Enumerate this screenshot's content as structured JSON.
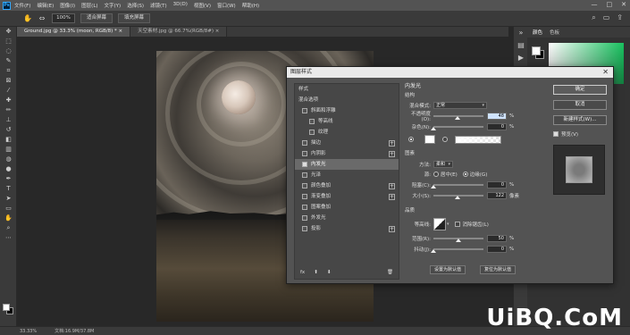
{
  "menubar": {
    "logo": "Ps",
    "items": [
      "文件(F)",
      "编辑(E)",
      "图像(I)",
      "图层(L)",
      "文字(Y)",
      "选择(S)",
      "滤镜(T)",
      "3D(D)",
      "视图(V)",
      "窗口(W)",
      "帮助(H)"
    ],
    "window_controls": [
      "—",
      "□",
      "✕"
    ]
  },
  "options": {
    "zoom_value": "100%",
    "fit_screen": "适合屏幕",
    "fill_screen": "填充屏幕"
  },
  "tabs": [
    {
      "label": "Ground.jpg @ 33.3% (moon, RGB/8) * ×",
      "active": true
    },
    {
      "label": "天空素材.jpg @ 66.7%(RGB/8#) ×",
      "active": false
    }
  ],
  "statusbar": {
    "zoom": "33.33%",
    "doc": "文档:16.9M/37.8M"
  },
  "right_panel": {
    "tabs": [
      "颜色",
      "色板"
    ],
    "accent_green": "#19c15f"
  },
  "dialog": {
    "title": "图层样式",
    "close": "✕",
    "list_header": "样式",
    "blend_options": "混合选项",
    "items": [
      {
        "label": "斜面和浮雕",
        "checked": false,
        "indent": false,
        "plus": false
      },
      {
        "label": "等高线",
        "checked": false,
        "indent": true,
        "plus": false
      },
      {
        "label": "纹理",
        "checked": false,
        "indent": true,
        "plus": false
      },
      {
        "label": "描边",
        "checked": false,
        "indent": false,
        "plus": true
      },
      {
        "label": "内阴影",
        "checked": false,
        "indent": false,
        "plus": true
      },
      {
        "label": "内发光",
        "checked": true,
        "indent": false,
        "plus": false,
        "selected": true
      },
      {
        "label": "光泽",
        "checked": false,
        "indent": false,
        "plus": false
      },
      {
        "label": "颜色叠加",
        "checked": false,
        "indent": false,
        "plus": true
      },
      {
        "label": "渐变叠加",
        "checked": false,
        "indent": false,
        "plus": true
      },
      {
        "label": "图案叠加",
        "checked": false,
        "indent": false,
        "plus": false
      },
      {
        "label": "外发光",
        "checked": false,
        "indent": false,
        "plus": false
      },
      {
        "label": "投影",
        "checked": false,
        "indent": false,
        "plus": true
      }
    ],
    "footer": [
      "fx",
      "⬆",
      "⬇",
      "🗑"
    ],
    "section_title": "内发光",
    "structure": {
      "title": "结构",
      "blend_mode_label": "混合模式:",
      "blend_mode": "正常",
      "opacity_label": "不透明度(O):",
      "opacity": "48",
      "opacity_level": 0.48,
      "noise_label": "杂色(N):",
      "noise": "0",
      "noise_level": 0,
      "unit_pct": "%"
    },
    "elements": {
      "title": "图素",
      "method_label": "方法:",
      "method": "柔和",
      "source_label": "源:",
      "source_center": "居中(E)",
      "source_edge": "边缘(G)",
      "choke_label": "阻塞(C):",
      "choke": "0",
      "choke_level": 0,
      "size_label": "大小(S):",
      "size": "122",
      "size_level": 0.49,
      "unit_px": "像素"
    },
    "quality": {
      "title": "品质",
      "contour_label": "等高线:",
      "anti_alias": "消除锯齿(L)",
      "range_label": "范围(R):",
      "range": "50",
      "range_level": 0.5,
      "jitter_label": "抖动(J):",
      "jitter": "0",
      "jitter_level": 0,
      "unit_pct": "%"
    },
    "default_set": "设置为默认值",
    "default_reset": "复位为默认值",
    "buttons": {
      "ok": "确定",
      "cancel": "取消",
      "new_style": "新建样式(W)...",
      "preview": "预览(V)"
    }
  },
  "watermark": "UiBQ.CoM"
}
